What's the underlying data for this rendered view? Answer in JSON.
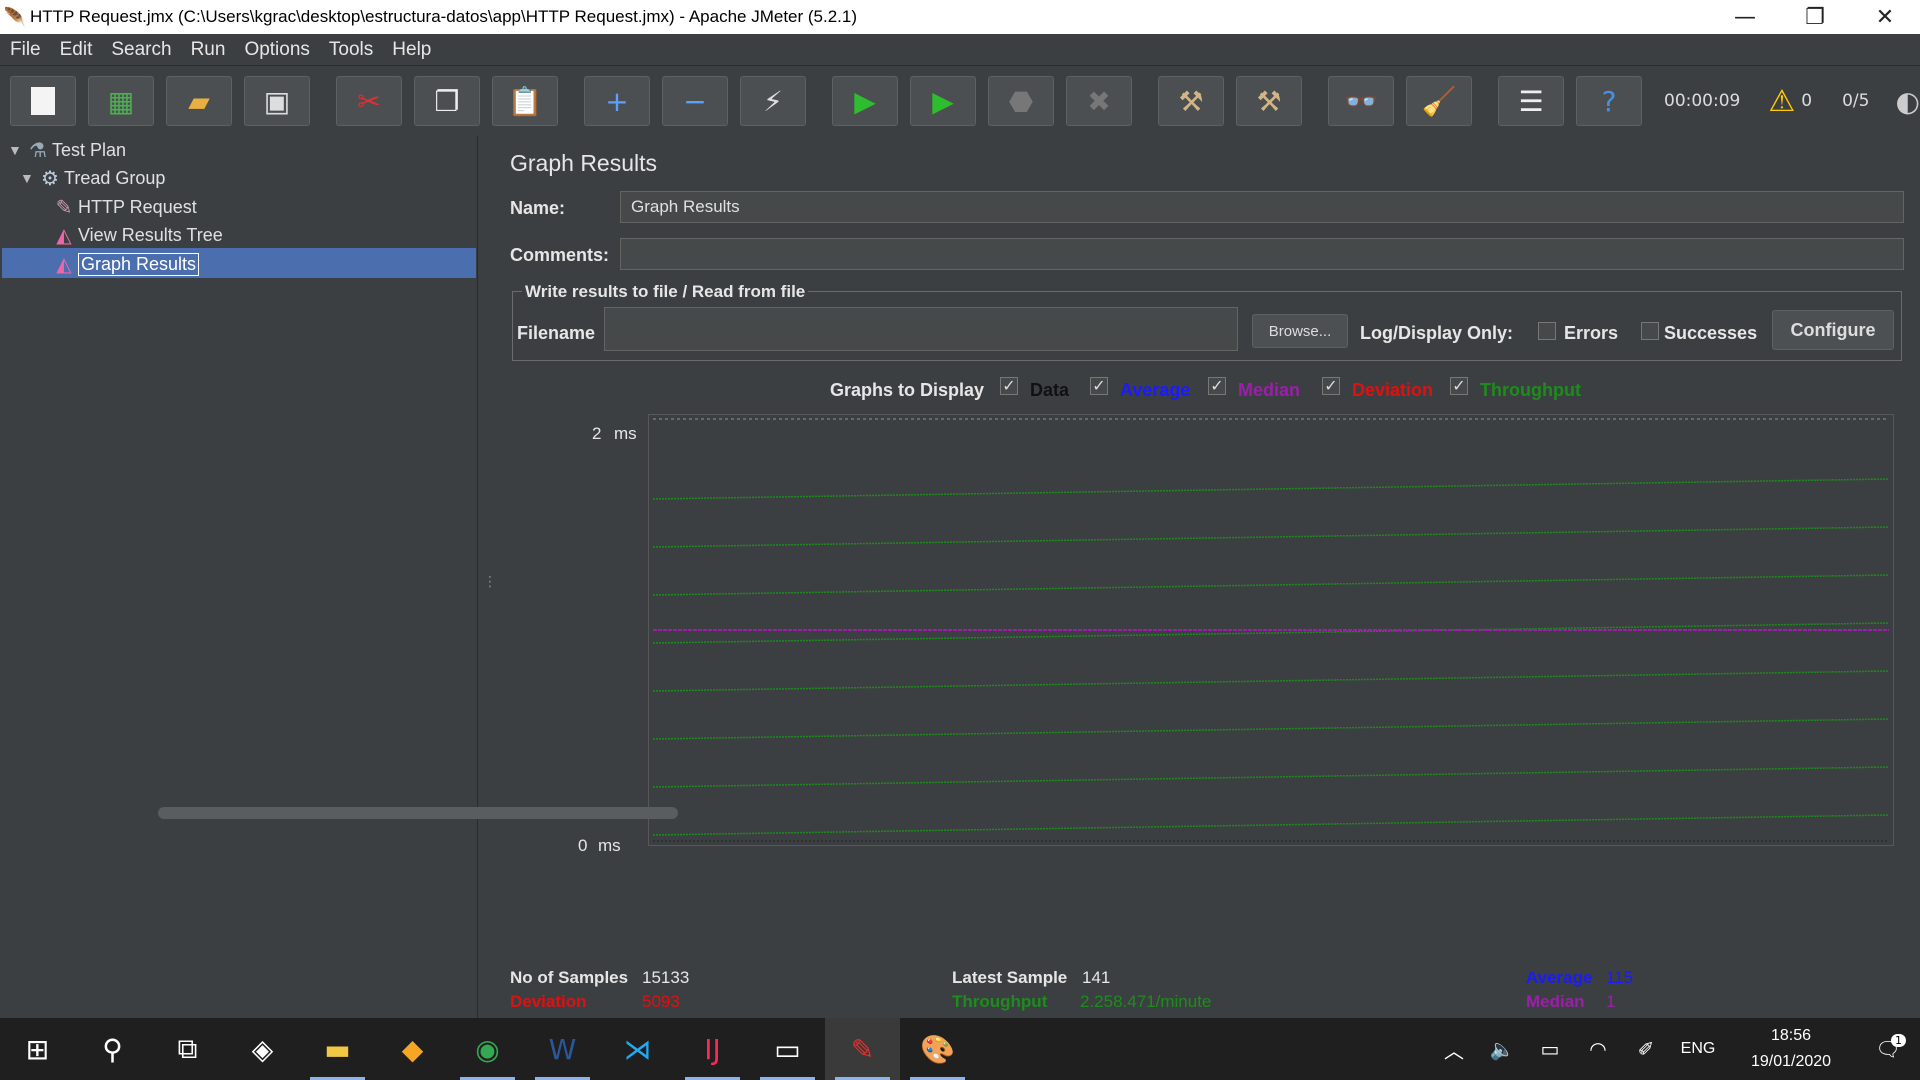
{
  "window": {
    "title": "HTTP Request.jmx (C:\\Users\\kgrac\\desktop\\estructura-datos\\app\\HTTP Request.jmx) - Apache JMeter (5.2.1)",
    "minimize": "—",
    "restore": "❐",
    "close": "✕"
  },
  "menu": [
    "File",
    "Edit",
    "Search",
    "Run",
    "Options",
    "Tools",
    "Help"
  ],
  "toolbar": {
    "elapsed_time": "00:00:09",
    "warning_count": "0",
    "active_threads": "0/5"
  },
  "tree": {
    "nodes": [
      {
        "label": "Test Plan",
        "icon": "flask-icon"
      },
      {
        "label": "Tread Group",
        "icon": "gear-icon"
      },
      {
        "label": "HTTP Request",
        "icon": "pipette-icon"
      },
      {
        "label": "View Results Tree",
        "icon": "chart-icon"
      },
      {
        "label": "Graph Results",
        "icon": "chart-icon",
        "selected": true
      }
    ]
  },
  "panel": {
    "title": "Graph Results",
    "name_label": "Name:",
    "name_value": "Graph Results",
    "comments_label": "Comments:",
    "comments_value": "",
    "file_section_legend": "Write results to file / Read from file",
    "filename_label": "Filename",
    "filename_value": "",
    "browse_button": "Browse...",
    "log_display_label": "Log/Display Only:",
    "errors_label": "Errors",
    "successes_label": "Successes",
    "configure_button": "Configure"
  },
  "graphs_to_display": {
    "label": "Graphs to Display",
    "options": [
      {
        "label": "Data",
        "checked": true,
        "color": "#111111"
      },
      {
        "label": "Average",
        "checked": true,
        "color": "#1a1aff"
      },
      {
        "label": "Median",
        "checked": true,
        "color": "#9b1fa8"
      },
      {
        "label": "Deviation",
        "checked": true,
        "color": "#e01010"
      },
      {
        "label": "Throughput",
        "checked": true,
        "color": "#1c8c1c"
      }
    ]
  },
  "chart_data": {
    "type": "line",
    "y_top_label": "2",
    "y_bottom_label": "0",
    "y_unit": "ms",
    "ylim": [
      0,
      2
    ],
    "series": [
      {
        "name": "Median",
        "color": "#9b1fa8",
        "values_ms": [
          1,
          1
        ]
      },
      {
        "name": "Throughput",
        "color": "#1c8c1c",
        "note": "repeating rising traces"
      }
    ]
  },
  "stats": {
    "samples_label": "No of Samples",
    "samples_value": "15133",
    "latest_label": "Latest Sample",
    "latest_value": "141",
    "average_label": "Average",
    "average_value": "115",
    "deviation_label": "Deviation",
    "deviation_value": "5093",
    "throughput_label": "Throughput",
    "throughput_value": "2.258.471/minute",
    "median_label": "Median",
    "median_value": "1"
  },
  "taskbar": {
    "language": "ENG",
    "time": "18:56",
    "date": "19/01/2020",
    "notifications": "1"
  }
}
